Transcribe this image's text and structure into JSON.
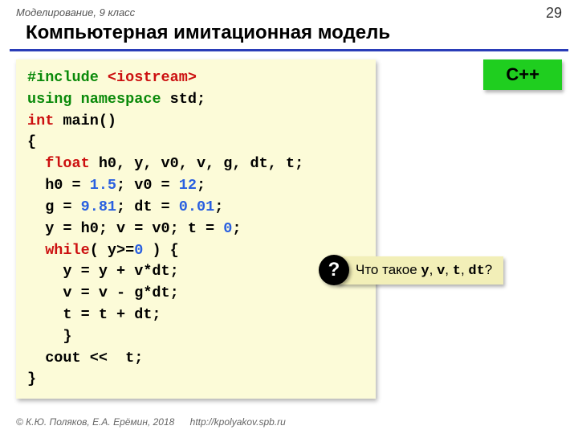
{
  "header": {
    "subject": "Моделирование, 9 класс",
    "page_number": "29",
    "title": "Компьютерная имитационная модель"
  },
  "badge": {
    "label": "C++"
  },
  "code": {
    "l1a": "#include ",
    "l1b": "<iostream>",
    "l2a": "using ",
    "l2b": "namespace ",
    "l2c": "std",
    "l2d": ";",
    "l3a": "int ",
    "l3b": "main()",
    "l4": "{",
    "l5a": "  float ",
    "l5b": "h0, y, v0, v, g, dt, t;",
    "l6a": "  h0 = ",
    "l6b": "1.5",
    "l6c": "; v0 = ",
    "l6d": "12",
    "l6e": ";",
    "l7a": "  g = ",
    "l7b": "9.81",
    "l7c": "; dt = ",
    "l7d": "0.01",
    "l7e": ";",
    "l8a": "  y = h0; v = v0; t = ",
    "l8b": "0",
    "l8c": ";",
    "l9a": "  while",
    "l9b": "( y>=",
    "l9c": "0",
    "l9d": " ) {",
    "l10": "    y = y + v*dt;",
    "l11": "    v = v - g*dt;",
    "l12": "    t = t + dt;",
    "l13": "    }",
    "l14a": "  cout ",
    "l14b": "<<  t;",
    "l15": "}"
  },
  "callout": {
    "mark": "?",
    "t1": "Что такое ",
    "v1": "y",
    "c1": ", ",
    "v2": "v",
    "c2": ", ",
    "v3": "t",
    "c3": ", ",
    "v4": "dt",
    "t2": "?"
  },
  "footer": {
    "copyright": "© К.Ю. Поляков, Е.А. Ерёмин, 2018",
    "url": "http://kpolyakov.spb.ru"
  }
}
